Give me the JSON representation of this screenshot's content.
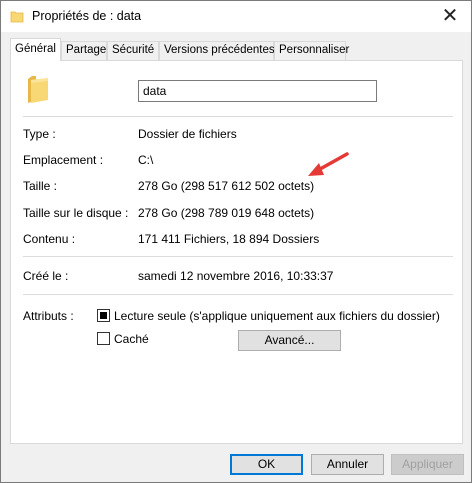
{
  "window": {
    "title": "Propriétés de : data",
    "close_glyph": "✕"
  },
  "tabs": [
    {
      "label": "Général",
      "active": true
    },
    {
      "label": "Partage"
    },
    {
      "label": "Sécurité"
    },
    {
      "label": "Versions précédentes"
    },
    {
      "label": "Personnaliser"
    }
  ],
  "general": {
    "name_value": "data",
    "props": [
      {
        "label": "Type :",
        "value": "Dossier de fichiers"
      },
      {
        "label": "Emplacement :",
        "value": "C:\\"
      },
      {
        "label": "Taille :",
        "value": "278 Go (298 517 612 502 octets)"
      },
      {
        "label": "Taille sur le disque :",
        "value": "278 Go (298 789 019 648 octets)"
      },
      {
        "label": "Contenu :",
        "value": "171 411 Fichiers, 18 894 Dossiers"
      }
    ],
    "created_label": "Créé le :",
    "created_value": "samedi 12 novembre 2016, 10:33:37",
    "attributes_label": "Attributs :",
    "readonly_label": "Lecture seule (s'applique uniquement aux fichiers du dossier)",
    "readonly_checked": true,
    "hidden_label": "Caché",
    "hidden_checked": false,
    "advanced_label": "Avancé..."
  },
  "footer": {
    "ok_label": "OK",
    "cancel_label": "Annuler",
    "apply_label": "Appliquer"
  },
  "icons": {
    "title": "folder-icon",
    "big": "folder-icon",
    "annotation": "red-arrow-icon"
  },
  "colors": {
    "folder": "#f8d775",
    "folder_dark": "#e8b74a",
    "annotation_arrow": "#e53935",
    "default_button_border": "#0078d7"
  }
}
